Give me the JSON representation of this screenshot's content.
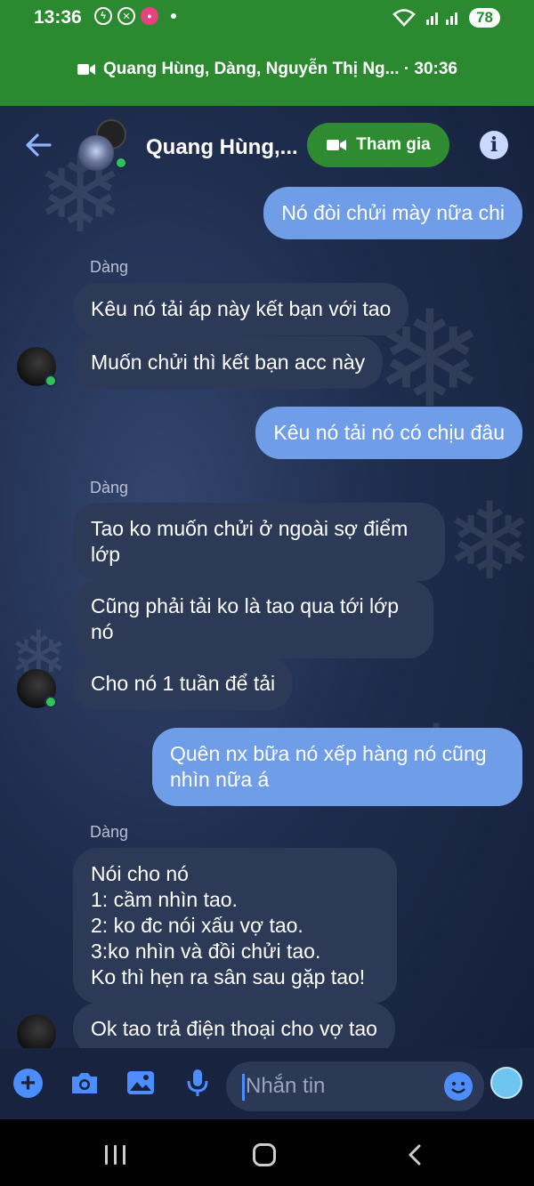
{
  "status_bar": {
    "time": "13:36",
    "battery": "78"
  },
  "call_banner": {
    "participants": "Quang Hùng, Dàng, Nguyễn Thị Ng... · 30:36"
  },
  "header": {
    "conversation_name": "Quang Hùng,...",
    "join_label": "Tham gia"
  },
  "messages": [
    {
      "direction": "out",
      "text": "Nó đòi chửi mày nữa chi"
    },
    {
      "sender": "Dàng"
    },
    {
      "direction": "in",
      "text": "Kêu nó tải áp này kết bạn với tao"
    },
    {
      "direction": "in",
      "text": "Muốn chửi thì kết bạn acc này"
    },
    {
      "direction": "out",
      "text": "Kêu nó tải nó có chịu đâu"
    },
    {
      "sender": "Dàng"
    },
    {
      "direction": "in",
      "text": "Tao ko muốn chửi ở ngoài sợ điểm\nlớp"
    },
    {
      "direction": "in",
      "text": "Cũng phải tải ko là tao qua tới lớp\nnó"
    },
    {
      "direction": "in",
      "text": "Cho nó 1 tuần để tải"
    },
    {
      "direction": "out",
      "text": "Quên nx bữa nó xếp hàng nó cũng\nnhìn nữa á"
    },
    {
      "sender": "Dàng"
    },
    {
      "direction": "in",
      "text": "Nói cho nó\n1: cầm nhìn tao.\n2: ko đc nói xấu vợ tao.\n3:ko nhìn và đồi chửi tao.\nKo thì hẹn ra sân sau gặp tao!"
    },
    {
      "direction": "in",
      "text": "Ok tao trả điện thoại cho vợ tao"
    }
  ],
  "composer": {
    "placeholder": "Nhắn tin"
  },
  "colors": {
    "call_green": "#2b8a2f",
    "outgoing_bubble": "#6f9de8",
    "incoming_bubble": "#2d3a57",
    "accent": "#4c8dff"
  },
  "icons": [
    "video-icon",
    "back-arrow-icon",
    "info-icon",
    "plus-icon",
    "camera-icon",
    "image-icon",
    "microphone-icon",
    "emoji-icon",
    "cold-face-emoji-icon"
  ]
}
